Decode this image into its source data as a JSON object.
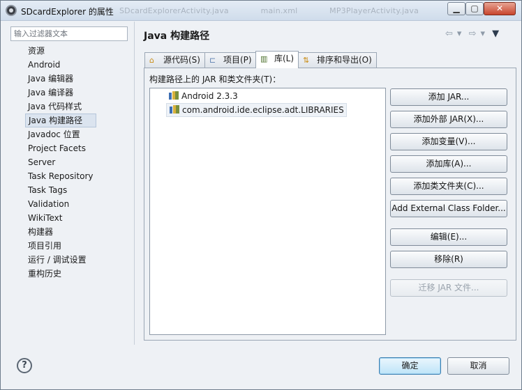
{
  "window": {
    "title": "SDcardExplorer 的属性",
    "background_tabs": [
      "SDcardExplorerActivity.java",
      "main.xml",
      "MP3PlayerActivity.java"
    ],
    "controls": {
      "minimize": "▁",
      "maximize": "▢",
      "close": "✕"
    }
  },
  "sidebar": {
    "filter_placeholder": "输入过滤器文本",
    "items": [
      {
        "label": "资源"
      },
      {
        "label": "Android"
      },
      {
        "label": "Java 编辑器"
      },
      {
        "label": "Java 编译器"
      },
      {
        "label": "Java 代码样式"
      },
      {
        "label": "Java 构建路径",
        "selected": true
      },
      {
        "label": "Javadoc 位置"
      },
      {
        "label": "Project Facets"
      },
      {
        "label": "Server"
      },
      {
        "label": "Task Repository"
      },
      {
        "label": "Task Tags"
      },
      {
        "label": "Validation"
      },
      {
        "label": "WikiText"
      },
      {
        "label": "构建器"
      },
      {
        "label": "项目引用"
      },
      {
        "label": "运行 / 调试设置"
      },
      {
        "label": "重构历史"
      }
    ]
  },
  "header": {
    "title": "Java 构建路径",
    "nav": {
      "back": "⇦",
      "back_menu": "▾",
      "forward": "⇨",
      "forward_menu": "▾",
      "view_menu": "▼"
    }
  },
  "tabs": [
    {
      "label": "源代码(S)",
      "icon": "source-folder-icon"
    },
    {
      "label": "项目(P)",
      "icon": "project-icon"
    },
    {
      "label": "库(L)",
      "icon": "library-icon",
      "active": true
    },
    {
      "label": "排序和导出(O)",
      "icon": "order-export-icon"
    }
  ],
  "libraries": {
    "section_label": "构建路径上的 JAR 和类文件夹(T)：",
    "entries": [
      {
        "label": "Android 2.3.3"
      },
      {
        "label": "com.android.ide.eclipse.adt.LIBRARIES",
        "selected": true
      }
    ]
  },
  "buttons": {
    "add_jar": "添加 JAR...",
    "add_external_jar": "添加外部 JAR(X)...",
    "add_variable": "添加变量(V)...",
    "add_library": "添加库(A)...",
    "add_class_folder": "添加类文件夹(C)...",
    "add_external_class_folder": "Add External Class Folder...",
    "edit": "编辑(E)...",
    "remove": "移除(R)",
    "migrate_jar": "迁移 JAR 文件..."
  },
  "footer": {
    "help": "?",
    "ok": "确定",
    "cancel": "取消"
  }
}
